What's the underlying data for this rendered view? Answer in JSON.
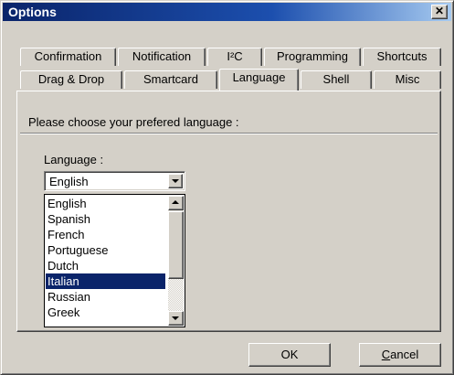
{
  "window": {
    "title": "Options",
    "close_glyph": "✕"
  },
  "tabs": {
    "back_row": [
      "Confirmation",
      "Notification",
      "I²C",
      "Programming",
      "Shortcuts"
    ],
    "front_row": [
      "Drag & Drop",
      "Smartcard",
      "Language",
      "Shell",
      "Misc"
    ],
    "active": "Language"
  },
  "panel": {
    "prompt": "Please choose your prefered language :",
    "language_label": "Language :"
  },
  "combo": {
    "value": "English"
  },
  "dropdown": {
    "options": [
      "English",
      "Spanish",
      "French",
      "Portuguese",
      "Dutch",
      "Italian",
      "Russian",
      "Greek"
    ],
    "highlighted": "Italian",
    "scroll_position": 0
  },
  "buttons": {
    "ok": "OK",
    "cancel_rest": "ancel",
    "cancel_mnemonic": "C"
  },
  "colors": {
    "title_start": "#0a246a",
    "title_end": "#a6caf0",
    "selection": "#0a246a",
    "face": "#d4d0c8"
  }
}
